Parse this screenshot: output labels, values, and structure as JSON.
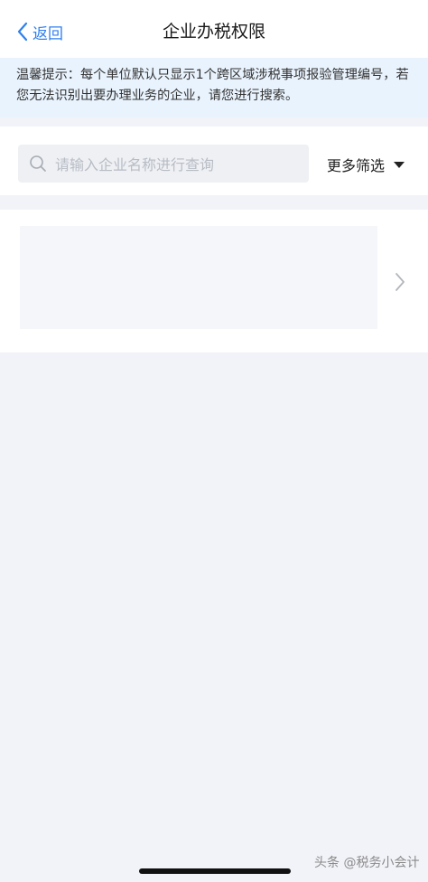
{
  "nav": {
    "back_label": "返回",
    "title": "企业办税权限"
  },
  "notice": {
    "text": "温馨提示：每个单位默认只显示1个跨区域涉税事项报验管理编号，若您无法识别出要办理业务的企业，请您进行搜索。"
  },
  "search": {
    "placeholder": "请输入企业名称进行查询",
    "filter_label": "更多筛选"
  },
  "watermark": {
    "text": "头条 @税务小会计"
  },
  "colors": {
    "accent": "#2f7ff0",
    "notice_bg": "#e9f3fd",
    "page_bg": "#f2f3f8"
  }
}
